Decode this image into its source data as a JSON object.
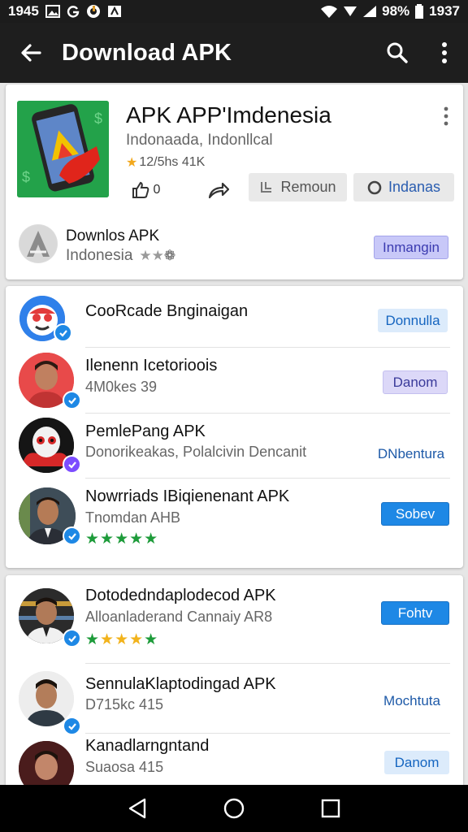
{
  "status_bar": {
    "time_left": "1945",
    "battery": "98%",
    "time_right": "1937"
  },
  "app_bar": {
    "title": "Download APK",
    "icons": [
      "back-arrow-icon",
      "search-icon",
      "more-vert-icon"
    ]
  },
  "featured": {
    "title": "APK APP'Imdenesia",
    "subtitle": "Indonaada, Indonllcal",
    "rating": "12/5hs 41K",
    "like_count": "0",
    "remove_label": "Remoun",
    "indonesia_label": "Indanas",
    "sub_title": "Downlos APK",
    "sub_subtitle": "Indonesia",
    "sub_button": "Inmangin"
  },
  "list1": [
    {
      "title": "CooRcade Bnginaigan",
      "subtitle": "",
      "button": "Donnulla",
      "button_style": "light"
    },
    {
      "title": "Ilenenn Icetorioois",
      "subtitle": "4M0kes 39",
      "button": "Danom",
      "button_style": "lavender"
    },
    {
      "title": "PemlePang APK",
      "subtitle": "Donorikeakas, Polalcivin Dencanit",
      "button": "DNbentura",
      "button_style": "text"
    },
    {
      "title": "Nowrriads IBiqienenant APK",
      "subtitle": "Tnomdan AHB",
      "stars": "★★★★★",
      "button": "Sobev",
      "button_style": "solid"
    }
  ],
  "list2": [
    {
      "title": "Dotodedndaplodecod APK",
      "subtitle": "Alloanladerand Cannaiy AR8",
      "stars": "★★★★★",
      "button": "Fohtv",
      "button_style": "solid"
    },
    {
      "title": "SennulaKlaptodingad APK",
      "subtitle": "D715kc 415",
      "button": "Mochtuta",
      "button_style": "text"
    },
    {
      "title": "Kanadlarngntand",
      "subtitle": "Suaosa 415",
      "button": "Danom",
      "button_style": "light"
    }
  ],
  "nav_bar": {
    "icons": [
      "back-triangle-icon",
      "home-circle-icon",
      "recents-square-icon"
    ]
  },
  "colors": {
    "app_bar": "#1e1e1e",
    "accent_blue": "#1e88e5",
    "star_green": "#1d9b3a",
    "verified_blue": "#1e88e5",
    "verified_purple": "#7c4dff"
  }
}
